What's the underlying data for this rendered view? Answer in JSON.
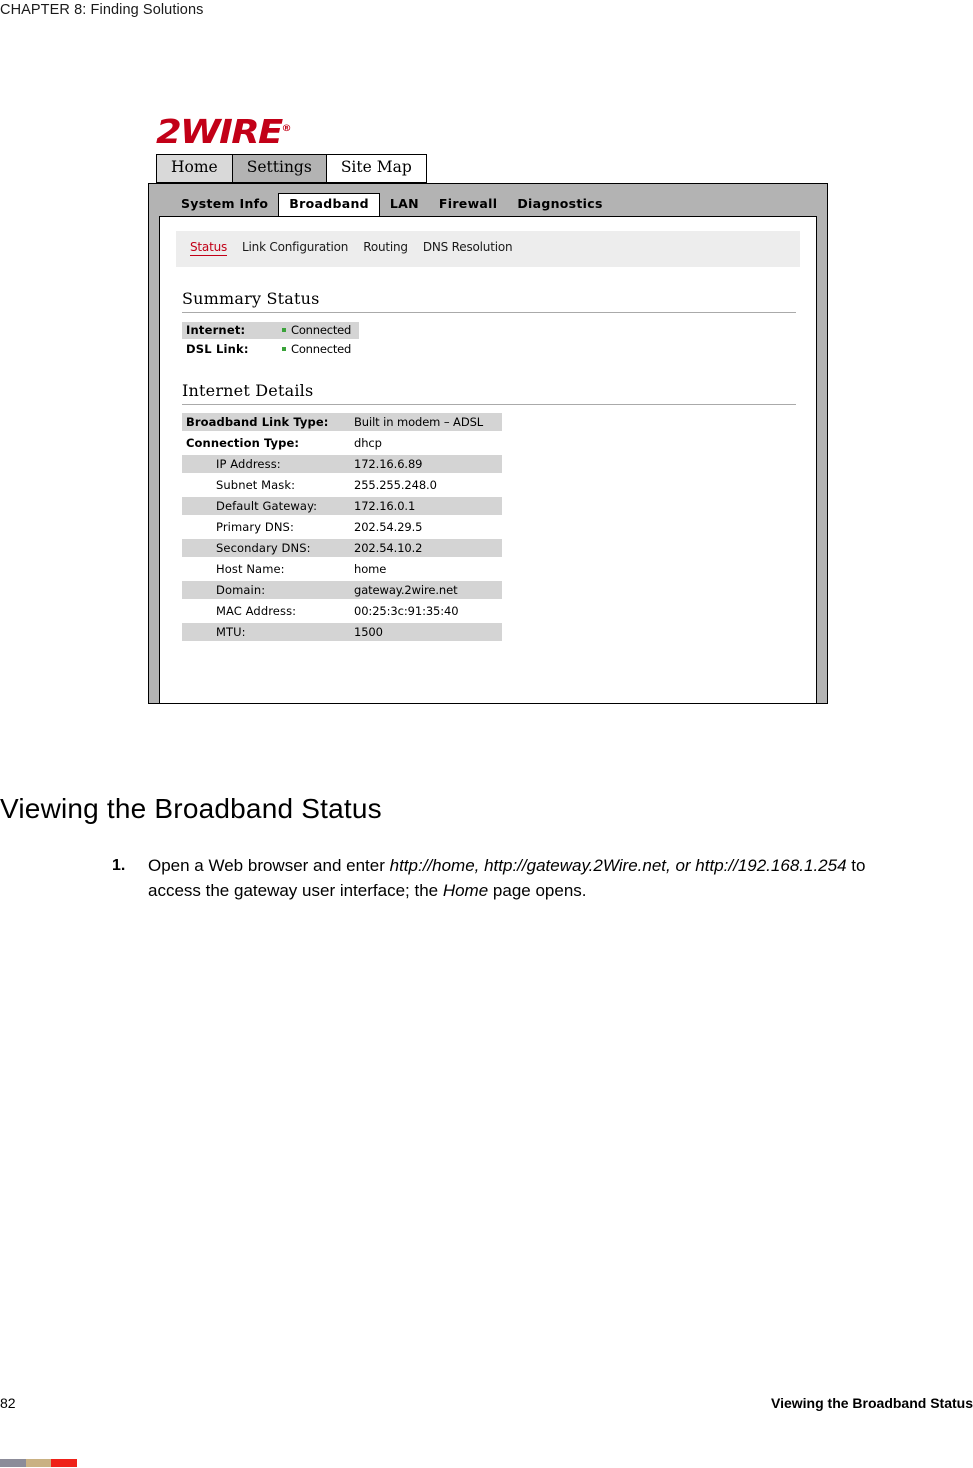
{
  "running_header": "CHAPTER 8: Finding Solutions",
  "figure": {
    "logo": {
      "text": "2WIRE",
      "mark": "®",
      "color": "#c20017"
    },
    "top_tabs": [
      {
        "label": "Home",
        "state": "light"
      },
      {
        "label": "Settings",
        "state": "selected"
      },
      {
        "label": "Site Map",
        "state": "plain"
      }
    ],
    "nav_tabs": [
      {
        "label": "System Info",
        "active": false
      },
      {
        "label": "Broadband",
        "active": true
      },
      {
        "label": "LAN",
        "active": false
      },
      {
        "label": "Firewall",
        "active": false
      },
      {
        "label": "Diagnostics",
        "active": false
      }
    ],
    "sub_nav": [
      {
        "label": "Status",
        "active": true
      },
      {
        "label": "Link Configuration",
        "active": false
      },
      {
        "label": "Routing",
        "active": false
      },
      {
        "label": "DNS Resolution",
        "active": false
      }
    ],
    "summary_status": {
      "title": "Summary Status",
      "rows": [
        {
          "label": "Internet:",
          "value": "Connected",
          "status_color": "#3aa33a",
          "shaded": true
        },
        {
          "label": "DSL Link:",
          "value": "Connected",
          "status_color": "#3aa33a",
          "shaded": false
        }
      ]
    },
    "internet_details": {
      "title": "Internet Details",
      "rows": [
        {
          "label": "Broadband Link Type:",
          "value": "Built in modem – ADSL",
          "bold": true,
          "indent": false,
          "shaded": true
        },
        {
          "label": "Connection Type:",
          "value": "dhcp",
          "bold": true,
          "indent": false,
          "shaded": false
        },
        {
          "label": "IP Address:",
          "value": "172.16.6.89",
          "bold": false,
          "indent": true,
          "shaded": true
        },
        {
          "label": "Subnet Mask:",
          "value": "255.255.248.0",
          "bold": false,
          "indent": true,
          "shaded": false
        },
        {
          "label": "Default Gateway:",
          "value": "172.16.0.1",
          "bold": false,
          "indent": true,
          "shaded": true
        },
        {
          "label": "Primary DNS:",
          "value": "202.54.29.5",
          "bold": false,
          "indent": true,
          "shaded": false
        },
        {
          "label": "Secondary DNS:",
          "value": "202.54.10.2",
          "bold": false,
          "indent": true,
          "shaded": true
        },
        {
          "label": "Host Name:",
          "value": "home",
          "bold": false,
          "indent": true,
          "shaded": false
        },
        {
          "label": "Domain:",
          "value": "gateway.2wire.net",
          "bold": false,
          "indent": true,
          "shaded": true
        },
        {
          "label": "MAC Address:",
          "value": "00:25:3c:91:35:40",
          "bold": false,
          "indent": true,
          "shaded": false
        },
        {
          "label": "MTU:",
          "value": "1500",
          "bold": false,
          "indent": true,
          "shaded": true
        }
      ]
    }
  },
  "body": {
    "heading": "Viewing the Broadband Status",
    "step_number": "1.",
    "step_parts": {
      "p1": "Open a Web browser and enter ",
      "i1": "http://home, http://gateway.2Wire.net, or http://192.168.1.254",
      "p2": " to access the gateway user interface; the ",
      "i2": "Home",
      "p3": " page opens."
    }
  },
  "footer": {
    "page_number": "82",
    "title": "Viewing the Broadband Status"
  }
}
